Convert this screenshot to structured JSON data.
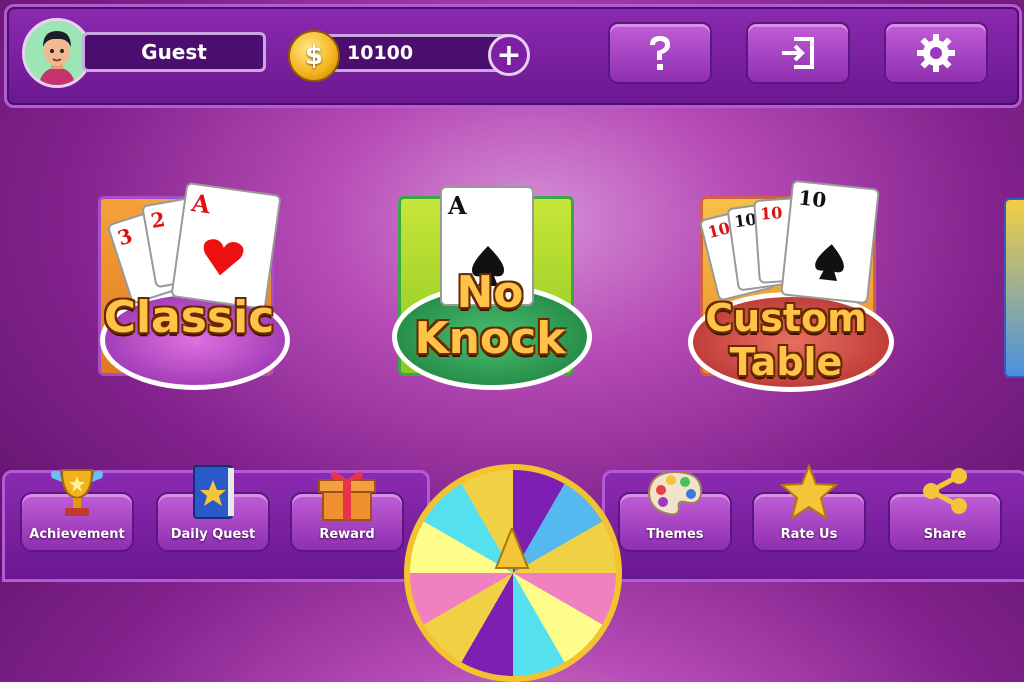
{
  "player": {
    "name": "Guest",
    "coins": "10100"
  },
  "top_buttons": {
    "help_icon": "question-icon",
    "exit_icon": "exit-icon",
    "settings_icon": "gear-icon"
  },
  "modes": [
    {
      "title": "Classic",
      "cards": [
        "3",
        "2",
        "A"
      ]
    },
    {
      "title_line1": "No",
      "title_line2": "Knock",
      "cards": [
        "A"
      ]
    },
    {
      "title_line1": "Custom",
      "title_line2": "Table",
      "cards": [
        "10",
        "10",
        "10",
        "10"
      ]
    }
  ],
  "bottom_left": [
    {
      "label": "Achievement",
      "icon": "trophy-icon"
    },
    {
      "label": "Daily Quest",
      "icon": "book-icon"
    },
    {
      "label": "Reward",
      "icon": "gift-icon"
    }
  ],
  "bottom_right": [
    {
      "label": "Themes",
      "icon": "palette-icon"
    },
    {
      "label": "Rate Us",
      "icon": "star-icon"
    },
    {
      "label": "Share",
      "icon": "share-icon"
    }
  ],
  "colors": {
    "accent_gold": "#ffc34a",
    "panel_purple": "#6a1890",
    "button_purple": "#c25ed8"
  }
}
